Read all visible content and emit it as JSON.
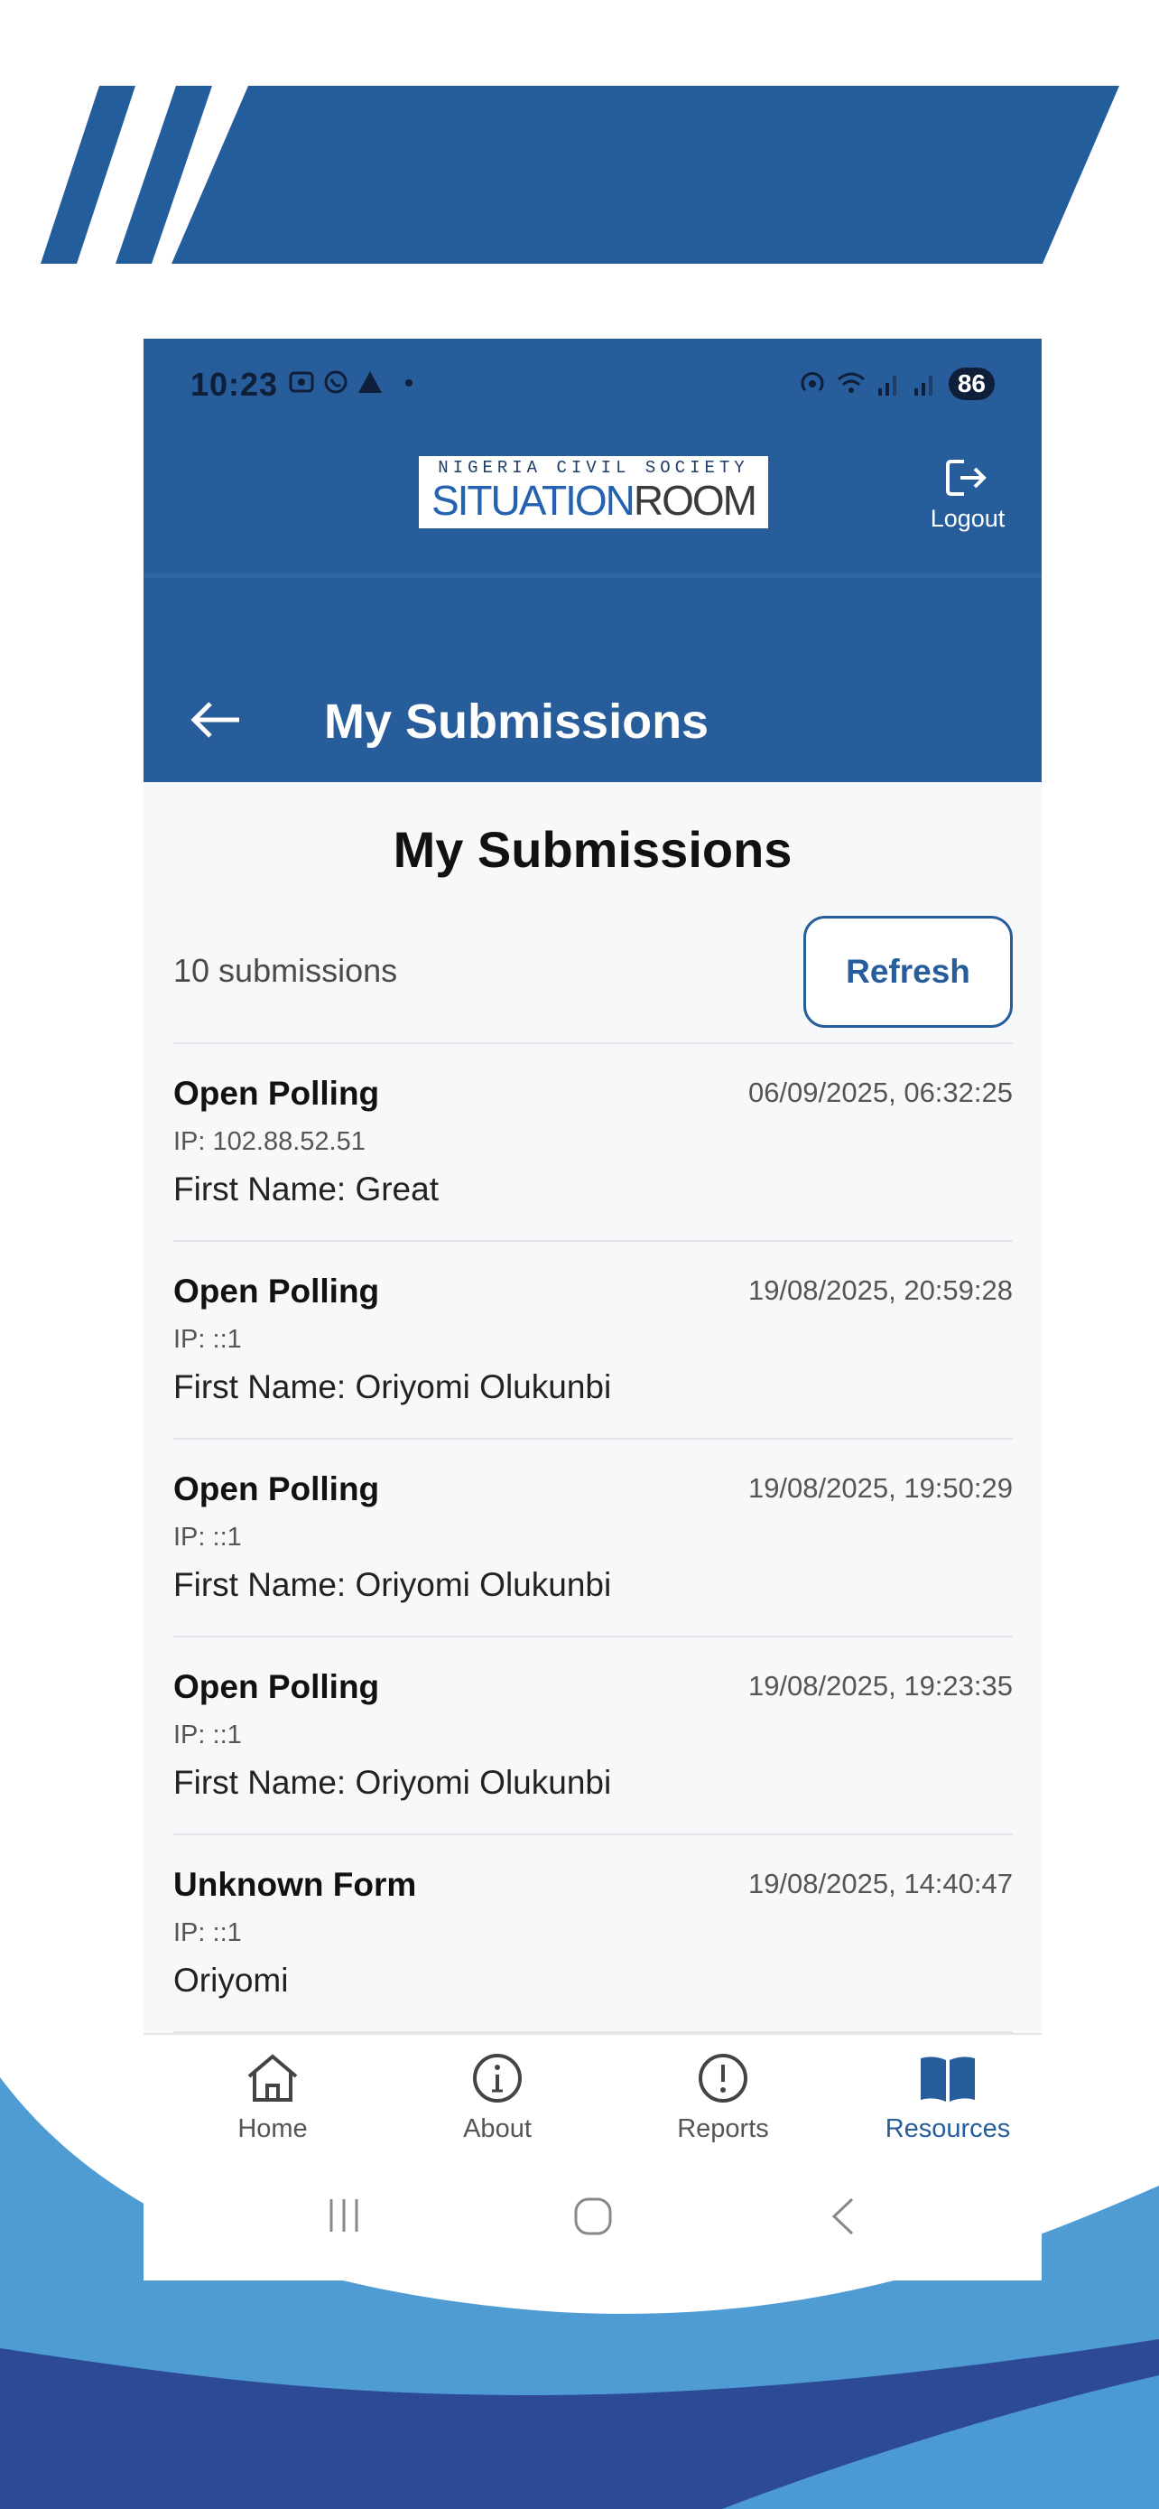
{
  "colors": {
    "brand_blue": "#275d9b",
    "banner_blue": "#245d9c",
    "wave_light": "#4f9bd4",
    "wave_dark": "#2d4a94",
    "background": "#f7f8fa"
  },
  "status_bar": {
    "time": "10:23",
    "left_icons": [
      "screenshot-icon",
      "whatsapp-icon",
      "warning-icon",
      "dot-icon"
    ],
    "right_icons": [
      "hotspot-icon",
      "wifi-icon",
      "signal-icon",
      "signal-icon"
    ],
    "battery": "86"
  },
  "header": {
    "logo_top": "NIGERIA CIVIL SOCIETY",
    "logo_main_a": "SITUATION",
    "logo_main_b": "ROOM",
    "logout_label": "Logout"
  },
  "title_bar": {
    "title": "My Submissions"
  },
  "content": {
    "heading": "My Submissions",
    "count": "10 submissions",
    "refresh_label": "Refresh",
    "submissions": [
      {
        "title": "Open Polling",
        "date": "06/09/2025, 06:32:25",
        "ip": "IP: 102.88.52.51",
        "detail": "First Name: Great"
      },
      {
        "title": "Open Polling",
        "date": "19/08/2025, 20:59:28",
        "ip": "IP: ::1",
        "detail": "First Name: Oriyomi Olukunbi"
      },
      {
        "title": "Open Polling",
        "date": "19/08/2025, 19:50:29",
        "ip": "IP: ::1",
        "detail": "First Name: Oriyomi Olukunbi"
      },
      {
        "title": "Open Polling",
        "date": "19/08/2025, 19:23:35",
        "ip": "IP: ::1",
        "detail": "First Name: Oriyomi Olukunbi"
      },
      {
        "title": "Unknown Form",
        "date": "19/08/2025, 14:40:47",
        "ip": "IP: ::1",
        "detail": "Oriyomi"
      }
    ]
  },
  "bottom_nav": {
    "items": [
      {
        "label": "Home",
        "icon": "home-icon"
      },
      {
        "label": "About",
        "icon": "info-icon"
      },
      {
        "label": "Reports",
        "icon": "alert-icon"
      },
      {
        "label": "Resources",
        "icon": "book-icon",
        "active": true
      }
    ]
  },
  "system_nav": {
    "buttons": [
      "recents-icon",
      "home-circle-icon",
      "back-chevron-icon"
    ]
  }
}
